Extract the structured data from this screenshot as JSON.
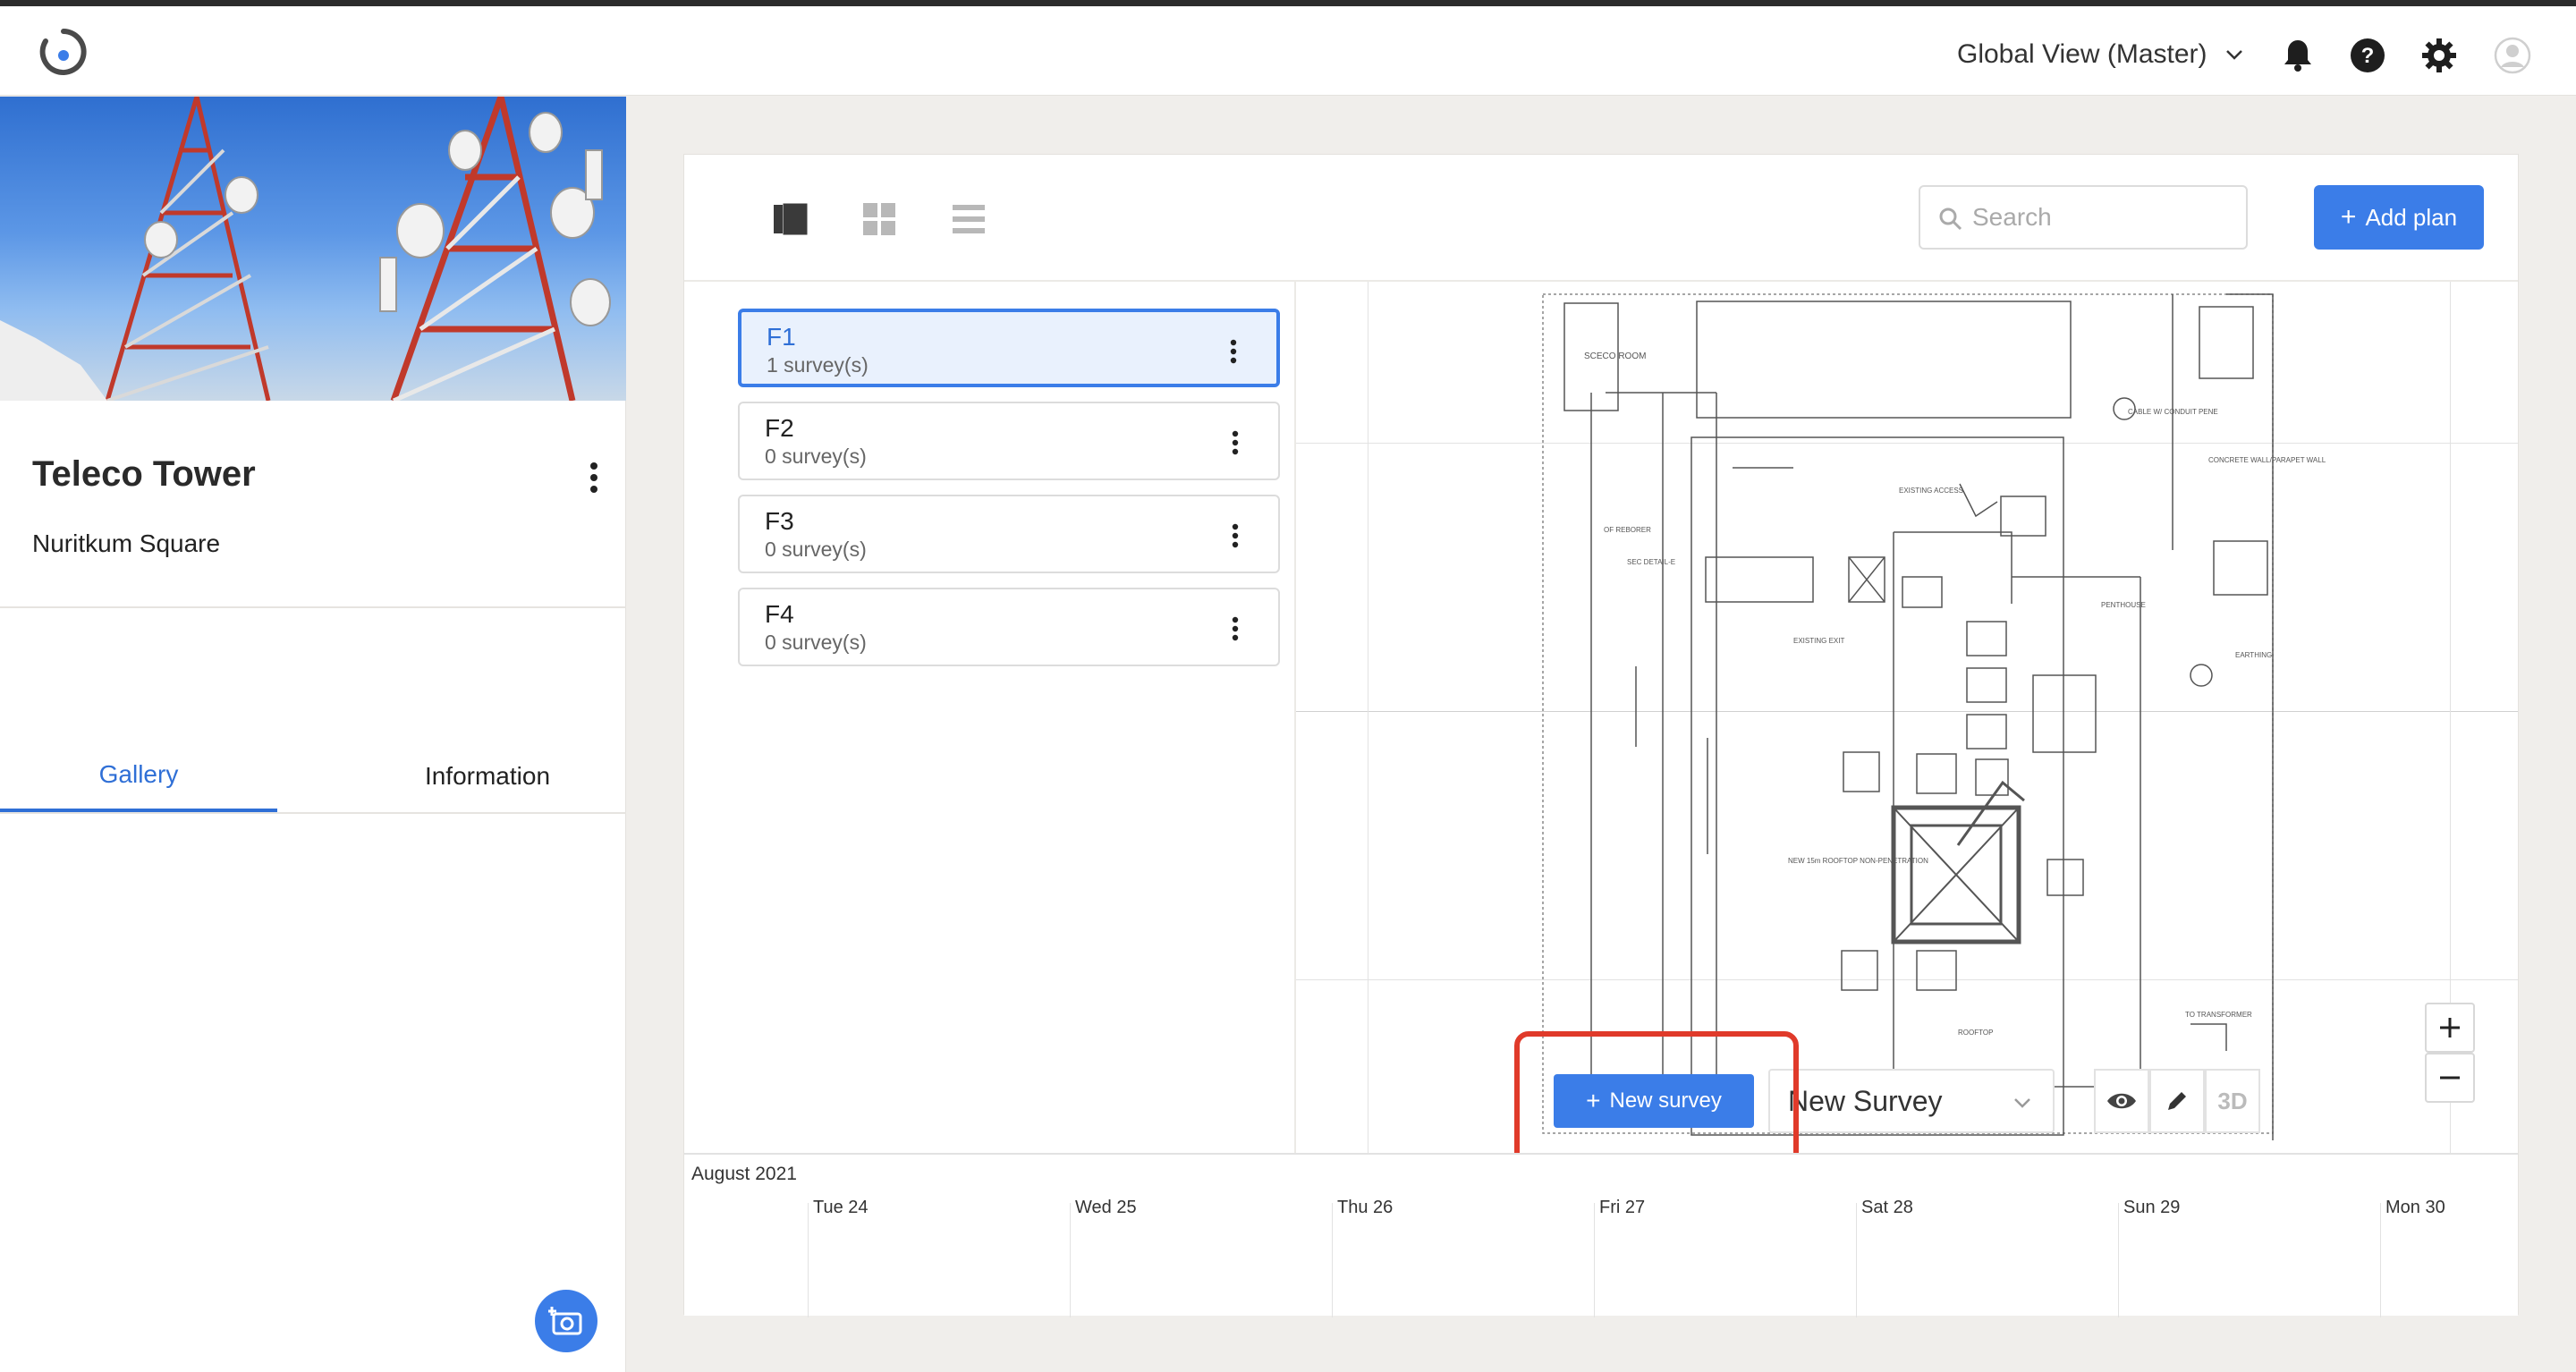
{
  "topbar": {
    "view_selector": "Global View (Master)",
    "icons": [
      "bell-icon",
      "help-icon",
      "gear-icon",
      "user-avatar-icon"
    ]
  },
  "project": {
    "title": "Teleco Tower",
    "subtitle": "Nuritkum Square",
    "tabs": [
      {
        "label": "Gallery",
        "active": true
      },
      {
        "label": "Information",
        "active": false
      }
    ]
  },
  "toolbar": {
    "search_placeholder": "Search",
    "add_plan_label": "Add plan"
  },
  "plans": [
    {
      "name": "F1",
      "surveys": "1 survey(s)",
      "selected": true
    },
    {
      "name": "F2",
      "surveys": "0 survey(s)",
      "selected": false
    },
    {
      "name": "F3",
      "surveys": "0 survey(s)",
      "selected": false
    },
    {
      "name": "F4",
      "surveys": "0 survey(s)",
      "selected": false
    }
  ],
  "survey_controls": {
    "new_survey_label": "New survey",
    "selected_survey": "New Survey",
    "three_d_label": "3D"
  },
  "timeline": {
    "month": "August 2021",
    "days": [
      "Tue 24",
      "Wed 25",
      "Thu 26",
      "Fri 27",
      "Sat 28",
      "Sun 29",
      "Mon 30"
    ]
  },
  "colors": {
    "accent": "#3b7de8",
    "highlight": "#e03a2a"
  }
}
